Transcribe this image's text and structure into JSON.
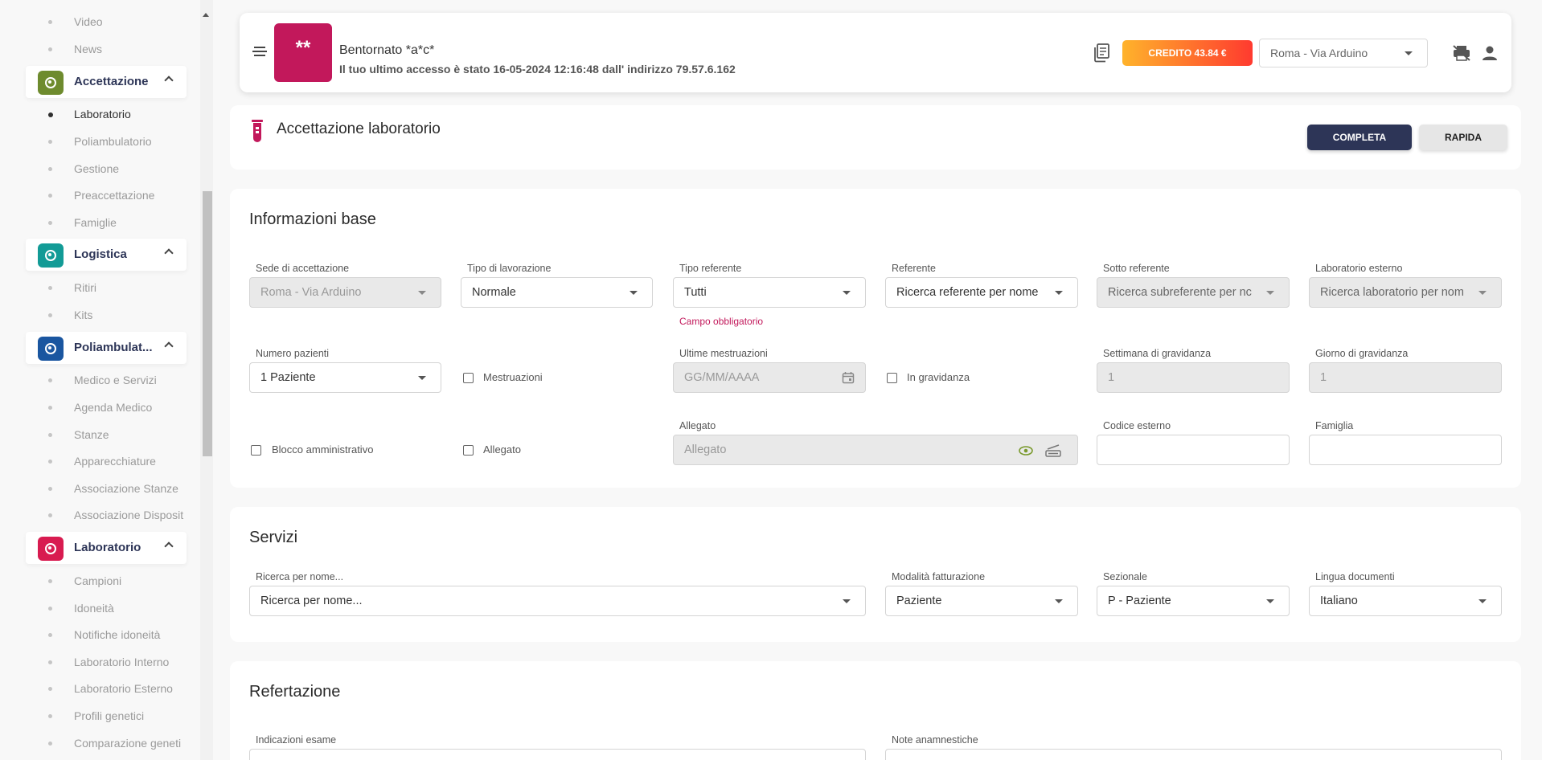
{
  "sidebar": {
    "items_top": [
      {
        "label": "Video"
      },
      {
        "label": "News"
      }
    ],
    "groups": [
      {
        "label": "Accettazione",
        "color": "#6e8b2e",
        "items": [
          {
            "label": "Laboratorio",
            "active": true
          },
          {
            "label": "Poliambulatorio"
          },
          {
            "label": "Gestione"
          },
          {
            "label": "Preaccettazione"
          },
          {
            "label": "Famiglie"
          }
        ]
      },
      {
        "label": "Logistica",
        "color": "#129b96",
        "items": [
          {
            "label": "Ritiri"
          },
          {
            "label": "Kits"
          }
        ]
      },
      {
        "label": "Poliambulat...",
        "color": "#1a56a0",
        "items": [
          {
            "label": "Medico e Servizi"
          },
          {
            "label": "Agenda Medico"
          },
          {
            "label": "Stanze"
          },
          {
            "label": "Apparecchiature"
          },
          {
            "label": "Associazione Stanze"
          },
          {
            "label": "Associazione Disposit"
          }
        ]
      },
      {
        "label": "Laboratorio",
        "color": "#d81b50",
        "items": [
          {
            "label": "Campioni"
          },
          {
            "label": "Idoneità"
          },
          {
            "label": "Notifiche idoneità"
          },
          {
            "label": "Laboratorio Interno"
          },
          {
            "label": "Laboratorio Esterno"
          },
          {
            "label": "Profili genetici"
          },
          {
            "label": "Comparazione geneti"
          }
        ]
      }
    ]
  },
  "header": {
    "avatar_text": "**",
    "welcome": "Bentornato *a*c*",
    "last_access": "Il tuo ultimo accesso è stato 16-05-2024 12:16:48 dall' indirizzo 79.57.6.162",
    "credit": "CREDITO 43.84 €",
    "sede": "Roma - Via Arduino",
    "icons": [
      "document-icon",
      "no-print-icon",
      "user-icon"
    ]
  },
  "page": {
    "title": "Accettazione laboratorio",
    "btn_completa": "COMPLETA",
    "btn_rapida": "RAPIDA"
  },
  "info_base": {
    "title": "Informazioni base",
    "sede_label": "Sede di accettazione",
    "sede_value": "Roma - Via Arduino",
    "tipo_lav_label": "Tipo di lavorazione",
    "tipo_lav_value": "Normale",
    "tipo_ref_label": "Tipo referente",
    "tipo_ref_value": "Tutti",
    "campo_obbl": "Campo obbligatorio",
    "referente_label": "Referente",
    "referente_placeholder": "Ricerca referente per nome",
    "sotto_ref_label": "Sotto referente",
    "sotto_ref_placeholder": "Ricerca subreferente per nc",
    "lab_est_label": "Laboratorio esterno",
    "lab_est_placeholder": "Ricerca laboratorio per nom",
    "num_paz_label": "Numero pazienti",
    "num_paz_value": "1 Paziente",
    "mestruazioni": "Mestruazioni",
    "ult_mestr_label": "Ultime mestruazioni",
    "ult_mestr_placeholder": "GG/MM/AAAA",
    "in_gravidanza": "In gravidanza",
    "sett_grav_label": "Settimana di gravidanza",
    "sett_grav_value": "1",
    "giorno_grav_label": "Giorno di gravidanza",
    "giorno_grav_value": "1",
    "blocco_amm": "Blocco amministrativo",
    "allegato_chk": "Allegato",
    "allegato_label": "Allegato",
    "allegato_placeholder": "Allegato",
    "codice_est_label": "Codice esterno",
    "famiglia_label": "Famiglia"
  },
  "servizi": {
    "title": "Servizi",
    "ricerca_label": "Ricerca per nome...",
    "ricerca_placeholder": "Ricerca per nome...",
    "modalita_label": "Modalità fatturazione",
    "modalita_value": "Paziente",
    "sezionale_label": "Sezionale",
    "sezionale_value": "P - Paziente",
    "lingua_label": "Lingua documenti",
    "lingua_value": "Italiano"
  },
  "refertazione": {
    "title": "Refertazione",
    "indicazioni_label": "Indicazioni esame",
    "note_label": "Note anamnestiche"
  }
}
